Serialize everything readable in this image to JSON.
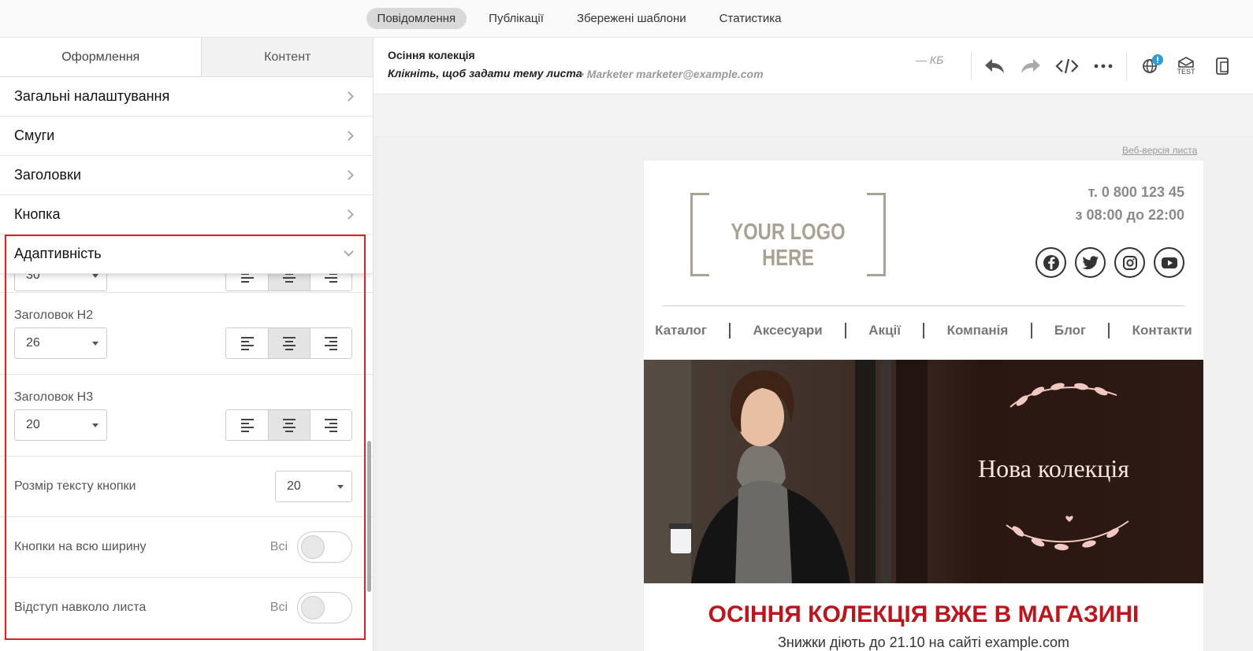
{
  "topnav": {
    "tabs": [
      "Повідомлення",
      "Публікації",
      "Збережені шаблони",
      "Статистика"
    ]
  },
  "panel": {
    "tabs": [
      "Оформлення",
      "Контент"
    ],
    "accordion": [
      "Загальні налаштування",
      "Смуги",
      "Заголовки",
      "Кнопка"
    ],
    "open_section": "Адаптивність",
    "h1_value": "30",
    "h2_label": "Заголовок H2",
    "h2_value": "26",
    "h3_label": "Заголовок H3",
    "h3_value": "20",
    "button_text_label": "Розмір тексту кнопки",
    "button_text_value": "20",
    "full_width_label": "Кнопки на всю ширину",
    "full_width_scope": "Всі",
    "padding_label": "Відступ навколо листа",
    "padding_scope": "Всі"
  },
  "editor": {
    "title": "Осіння колекція",
    "subject_hint": "Клікніть, щоб задати тему листа",
    "sender": "• Marketer marketer@example.com",
    "size": "— КБ",
    "test_label": "TEST",
    "web_version": "Веб-версія листа"
  },
  "email": {
    "logo": "YOUR LOGO HERE",
    "phone": "т. 0 800 123 45",
    "hours": "з 08:00 до 22:00",
    "menu": [
      "Каталог",
      "Аксесуари",
      "Акції",
      "Компанія",
      "Блог",
      "Контакти"
    ],
    "hero_title": "Нова колекція",
    "headline": "ОСІННЯ КОЛЕКЦІЯ ВЖЕ В МАГАЗИНІ",
    "subline": "Знижки діють до 21.10 на сайті example.com"
  },
  "colors": {
    "accent_red": "#c0131b",
    "highlight_border": "#e02020",
    "hero_bg": "#2e1a14"
  }
}
